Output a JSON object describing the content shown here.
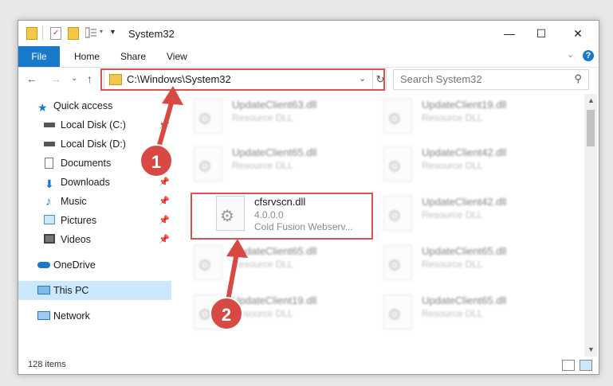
{
  "window": {
    "title": "System32",
    "minimize_glyph": "—",
    "maximize_glyph": "☐",
    "close_glyph": "✕"
  },
  "ribbon": {
    "tabs": [
      "File",
      "Home",
      "Share",
      "View"
    ],
    "help_glyph": "?"
  },
  "address": {
    "path": "C:\\Windows\\System32",
    "search_placeholder": "Search System32"
  },
  "sidebar": {
    "items": [
      {
        "label": "Quick access",
        "icon": "star-icon"
      },
      {
        "label": "Local Disk (C:)",
        "icon": "drive-icon"
      },
      {
        "label": "Local Disk (D:)",
        "icon": "drive-icon"
      },
      {
        "label": "Documents",
        "icon": "documents-icon"
      },
      {
        "label": "Downloads",
        "icon": "download-icon"
      },
      {
        "label": "Music",
        "icon": "music-icon"
      },
      {
        "label": "Pictures",
        "icon": "pictures-icon"
      },
      {
        "label": "Videos",
        "icon": "videos-icon"
      },
      {
        "label": "OneDrive",
        "icon": "cloud-icon"
      },
      {
        "label": "This PC",
        "icon": "computer-icon",
        "selected": true
      },
      {
        "label": "Network",
        "icon": "network-icon"
      }
    ]
  },
  "files": {
    "left": [
      {
        "name": "UpdateClient63.dll",
        "type": "Resource DLL"
      },
      {
        "name": "UpdateClient65.dll",
        "type": "Resource DLL"
      },
      {
        "name": "cfsrvscn.dll",
        "version": "4.0.0.0",
        "desc": "Cold Fusion Webserv..."
      },
      {
        "name": "UpdateClient65.dll",
        "type": "Resource DLL"
      },
      {
        "name": "UpdateClient19.dll",
        "type": "Resource DLL"
      }
    ],
    "right": [
      {
        "name": "UpdateClient19.dll",
        "type": "Resource DLL"
      },
      {
        "name": "UpdateClient42.dll",
        "type": "Resource DLL"
      },
      {
        "name": "UpdateClient42.dll",
        "type": "Resource DLL"
      },
      {
        "name": "UpdateClient65.dll",
        "type": "Resource DLL"
      },
      {
        "name": "UpdateClient65.dll",
        "type": "Resource DLL"
      }
    ]
  },
  "status": {
    "item_count": "128 items"
  },
  "annotations": {
    "step1": "1",
    "step2": "2"
  },
  "colors": {
    "accent": "#1979ca",
    "highlight_box": "#d9534f",
    "badge": "#d74942",
    "selected_bg": "#cce8ff"
  }
}
